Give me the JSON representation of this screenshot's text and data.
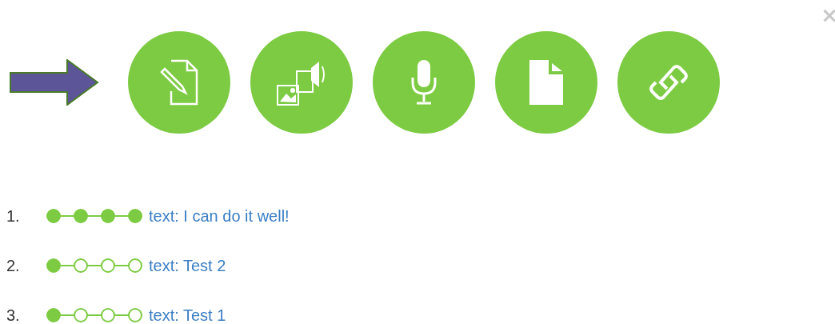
{
  "close": "×",
  "actions": [
    {
      "kind": "compose"
    },
    {
      "kind": "media"
    },
    {
      "kind": "microphone"
    },
    {
      "kind": "document"
    },
    {
      "kind": "link"
    }
  ],
  "entries": [
    {
      "number": "1.",
      "steps": [
        {
          "done": true
        },
        {
          "done": true
        },
        {
          "done": true
        },
        {
          "done": true
        }
      ],
      "text": "text: I can do it well!"
    },
    {
      "number": "2.",
      "steps": [
        {
          "done": true
        },
        {
          "done": false
        },
        {
          "done": false
        },
        {
          "done": false
        }
      ],
      "text": "text: Test 2"
    },
    {
      "number": "3.",
      "steps": [
        {
          "done": true
        },
        {
          "done": false
        },
        {
          "done": false
        },
        {
          "done": false
        }
      ],
      "text": "text: Test 1"
    }
  ]
}
